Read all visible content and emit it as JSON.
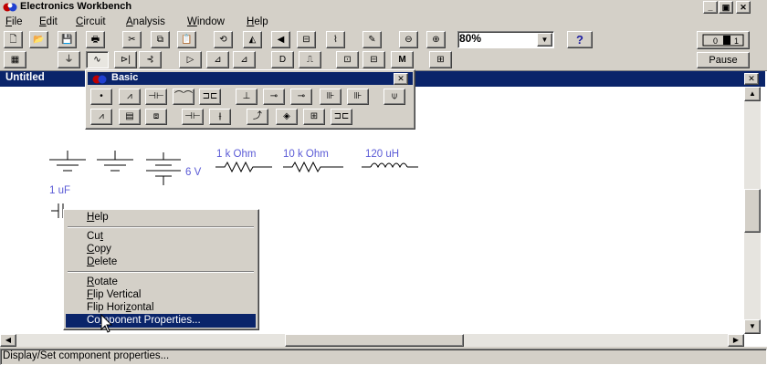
{
  "app": {
    "title": "Electronics Workbench"
  },
  "window_buttons": [
    "_",
    "▣",
    "✕"
  ],
  "menu": [
    {
      "pre": "",
      "ul": "F",
      "post": "ile"
    },
    {
      "pre": "",
      "ul": "E",
      "post": "dit"
    },
    {
      "pre": "",
      "ul": "C",
      "post": "ircuit"
    },
    {
      "pre": "",
      "ul": "A",
      "post": "nalysis"
    },
    {
      "pre": "",
      "ul": "W",
      "post": "indow"
    },
    {
      "pre": "",
      "ul": "H",
      "post": "elp"
    }
  ],
  "toolbar": {
    "zoom_value": "80%",
    "help_label": "?",
    "pause_label": "Pause",
    "buttons": [
      {
        "name": "new-icon",
        "glyph": "🗋"
      },
      {
        "name": "open-icon",
        "glyph": "📂"
      },
      {
        "name": "save-icon",
        "glyph": "💾"
      },
      {
        "name": "print-icon",
        "glyph": "🖶"
      },
      {
        "name": "cut-icon",
        "glyph": "✂"
      },
      {
        "name": "copy-icon",
        "glyph": "⧉"
      },
      {
        "name": "paste-icon",
        "glyph": "📋"
      },
      {
        "name": "rotate-icon",
        "glyph": "⟲"
      },
      {
        "name": "flip-horizontal-icon",
        "glyph": "◭"
      },
      {
        "name": "flip-vertical-icon",
        "glyph": "◀"
      },
      {
        "name": "subcircuit-icon",
        "glyph": "⊟"
      },
      {
        "name": "graph-icon",
        "glyph": "⌇"
      },
      {
        "name": "component-properties-icon",
        "glyph": "✎"
      },
      {
        "name": "zoom-out-icon",
        "glyph": "⊖"
      },
      {
        "name": "zoom-in-icon",
        "glyph": "⊕"
      }
    ],
    "parts_bins": [
      {
        "name": "favorites-icon",
        "glyph": "▦"
      },
      {
        "name": "sources-icon",
        "glyph": "⏚"
      },
      {
        "name": "basic-icon",
        "glyph": "∿"
      },
      {
        "name": "diodes-icon",
        "glyph": "⊳|"
      },
      {
        "name": "transistors-icon",
        "glyph": "⊰"
      },
      {
        "name": "analog-ics-icon",
        "glyph": "▷"
      },
      {
        "name": "mixed-ics-icon",
        "glyph": "⊿"
      },
      {
        "name": "digital-ics-icon",
        "glyph": "⊿"
      },
      {
        "name": "logic-gates-icon",
        "glyph": "D"
      },
      {
        "name": "digital-icon",
        "glyph": "⎍"
      },
      {
        "name": "indicators-icon",
        "glyph": "⊡"
      },
      {
        "name": "controls-icon",
        "glyph": "⊟"
      },
      {
        "name": "miscellaneous-icon",
        "glyph": "M"
      },
      {
        "name": "instruments-icon",
        "glyph": "⊞"
      }
    ]
  },
  "document": {
    "title": "Untitled"
  },
  "parts_bin": {
    "title": "Basic",
    "row1": [
      {
        "name": "connector-icon",
        "glyph": "•"
      },
      {
        "name": "resistor-icon",
        "glyph": "⩘"
      },
      {
        "name": "capacitor-icon",
        "glyph": "⊣⊢"
      },
      {
        "name": "inductor-icon",
        "glyph": "⌒⌒"
      },
      {
        "name": "transformer-icon",
        "glyph": "⊐⊏"
      },
      {
        "name": "relay-icon",
        "glyph": "⊥"
      },
      {
        "name": "switch-icon",
        "glyph": "⊸"
      },
      {
        "name": "time-delay-switch-icon",
        "glyph": "⊸"
      },
      {
        "name": "voltage-controlled-switch-icon",
        "glyph": "⊪"
      },
      {
        "name": "current-controlled-switch-icon",
        "glyph": "⊪"
      },
      {
        "name": "pullup-resistor-icon",
        "glyph": "⍦"
      }
    ],
    "row2": [
      {
        "name": "potentiometer-icon",
        "glyph": "⩘"
      },
      {
        "name": "resistor-pack-icon",
        "glyph": "▤"
      },
      {
        "name": "voltage-controlled-analog-switch-icon",
        "glyph": "⧈"
      },
      {
        "name": "polarized-capacitor-icon",
        "glyph": "⊣⊢"
      },
      {
        "name": "variable-capacitor-icon",
        "glyph": "⫲"
      },
      {
        "name": "variable-inductor-icon",
        "glyph": "⤴"
      },
      {
        "name": "coreless-coil-icon",
        "glyph": "◈"
      },
      {
        "name": "magnetic-core-icon",
        "glyph": "⊞"
      },
      {
        "name": "nonlinear-transformer-icon",
        "glyph": "⊐⊏"
      }
    ]
  },
  "circuit": {
    "voltage_label": "6 V",
    "resistor1_label": "1 k Ohm",
    "resistor2_label": "10 k Ohm",
    "inductor_label": "120 uH",
    "capacitor_label": "1 uF"
  },
  "context_menu": {
    "items": [
      {
        "key": "help",
        "pre": "",
        "ul": "H",
        "post": "elp"
      },
      {
        "key": "cut",
        "pre": "Cu",
        "ul": "t",
        "post": ""
      },
      {
        "key": "copy",
        "pre": "",
        "ul": "C",
        "post": "opy"
      },
      {
        "key": "delete",
        "pre": "",
        "ul": "D",
        "post": "elete"
      },
      {
        "key": "rotate",
        "pre": "",
        "ul": "R",
        "post": "otate"
      },
      {
        "key": "flip-vertical",
        "pre": "",
        "ul": "F",
        "post": "lip Vertical"
      },
      {
        "key": "flip-horizontal",
        "pre": "Flip Hori",
        "ul": "z",
        "post": "ontal"
      },
      {
        "key": "component-properties",
        "pre": "Co",
        "ul": "m",
        "post": "ponent Properties..."
      }
    ],
    "selected": "component-properties"
  },
  "status": {
    "text": "Display/Set component properties..."
  },
  "colors": {
    "title_bar": "#0a246a",
    "face": "#d4d0c8",
    "label": "#5b5bd6"
  }
}
